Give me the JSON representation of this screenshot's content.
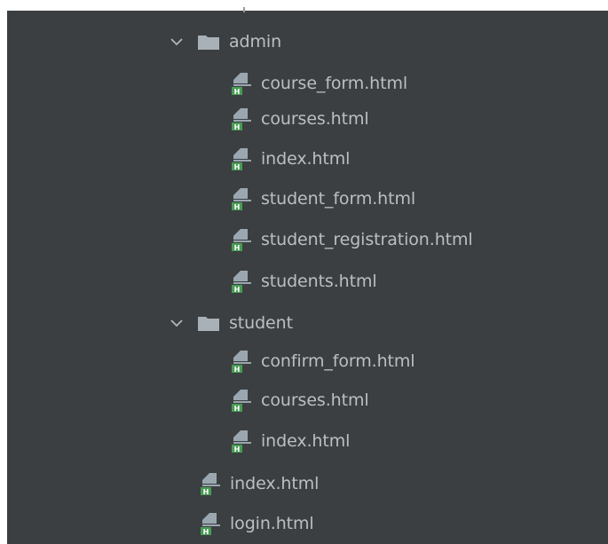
{
  "tree": {
    "folders": [
      {
        "name": "admin",
        "icon": "folder-icon",
        "expanded": true,
        "files": [
          {
            "name": "course_form.html",
            "icon": "html-file-icon"
          },
          {
            "name": "courses.html",
            "icon": "html-file-icon"
          },
          {
            "name": "index.html",
            "icon": "html-file-icon"
          },
          {
            "name": "student_form.html",
            "icon": "html-file-icon"
          },
          {
            "name": "student_registration.html",
            "icon": "html-file-icon"
          },
          {
            "name": "students.html",
            "icon": "html-file-icon"
          }
        ]
      },
      {
        "name": "student",
        "icon": "folder-icon",
        "expanded": true,
        "files": [
          {
            "name": "confirm_form.html",
            "icon": "html-file-icon"
          },
          {
            "name": "courses.html",
            "icon": "html-file-icon"
          },
          {
            "name": "index.html",
            "icon": "html-file-icon"
          }
        ]
      }
    ],
    "root_files": [
      {
        "name": "index.html",
        "icon": "html-file-icon"
      },
      {
        "name": "login.html",
        "icon": "html-file-icon"
      }
    ]
  },
  "colors": {
    "panel_background": "#3c3f41",
    "text": "#bcbec4",
    "folder": "#a9b1b8",
    "html_icon_green": "#499c54",
    "html_icon_gray": "#9aa7b0"
  }
}
